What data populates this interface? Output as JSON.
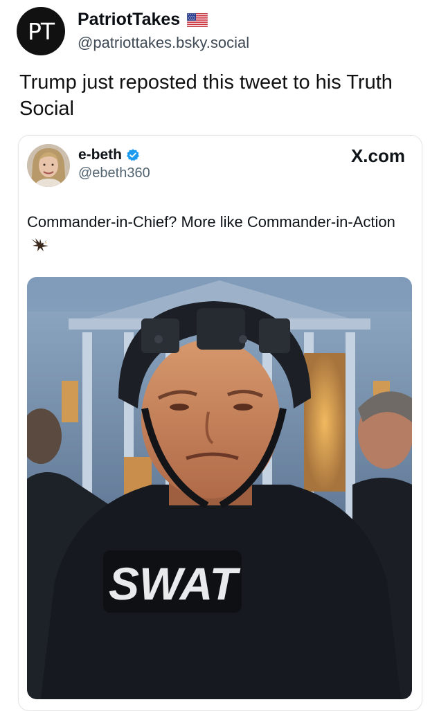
{
  "post": {
    "avatar_initials": "PT",
    "author_name": "PatriotTakes",
    "author_handle": "@patriottakes.bsky.social",
    "flag_icon": "us-flag-icon",
    "text": "Trump just reposted this tweet to his Truth Social"
  },
  "embed": {
    "name": "e-beth",
    "verified_icon": "verified-badge-icon",
    "handle": "@ebeth360",
    "site": "X.com",
    "text": "Commander-in-Chief? More like Commander-in-Action",
    "emoji_icon": "eagle-icon",
    "image": {
      "subject": "photo",
      "vest_text": "SWAT"
    }
  },
  "colors": {
    "verified_blue": "#1d9bf0",
    "text_primary": "#0f1419",
    "text_secondary": "#536471"
  }
}
